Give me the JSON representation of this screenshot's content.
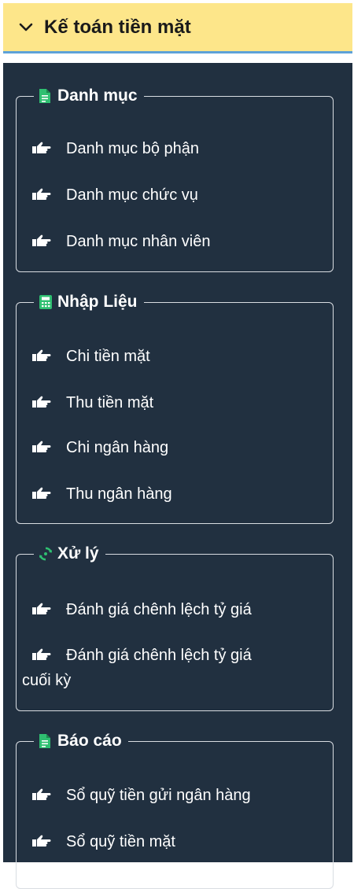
{
  "header": {
    "title": "Kế toán tiền mặt"
  },
  "groups": [
    {
      "title": "Danh mục",
      "icon": "document-icon",
      "items": [
        "Danh mục bộ phận",
        "Danh mục chức vụ",
        "Danh mục nhân viên"
      ]
    },
    {
      "title": "Nhập Liệu",
      "icon": "calculator-icon",
      "items": [
        "Chi tiền mặt",
        "Thu tiền mặt",
        "Chi ngân hàng",
        "Thu ngân hàng"
      ]
    },
    {
      "title": "Xử lý",
      "icon": "sync-icon",
      "items": [
        "Đánh giá chênh lệch tỷ giá",
        "Đánh giá chênh lệch tỷ giá cuối kỳ"
      ]
    },
    {
      "title": "Báo cáo",
      "icon": "document-icon",
      "items": [
        "Sổ quỹ tiền gửi ngân hàng",
        "Sổ quỹ tiền mặt"
      ]
    }
  ],
  "colors": {
    "header_bg": "#fde68a",
    "panel_bg": "#213040",
    "accent_green": "#2fbf71",
    "text": "#ffffff"
  }
}
